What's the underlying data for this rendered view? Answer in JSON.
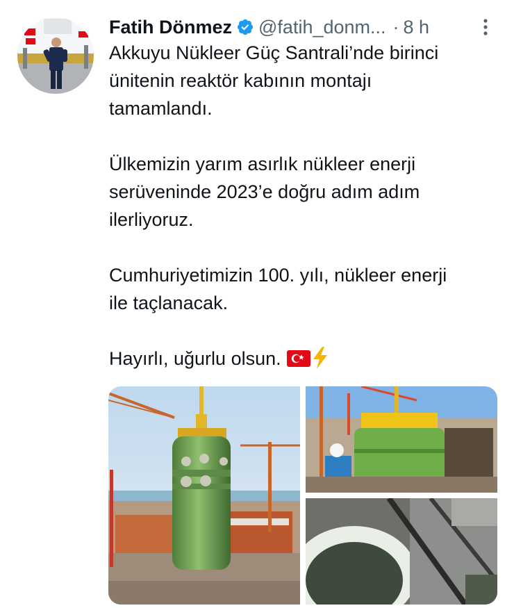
{
  "tweet": {
    "display_name": "Fatih Dönmez",
    "handle": "@fatih_donm...",
    "separator": "·",
    "time": "8 h",
    "paragraphs": [
      [
        "Akkuyu Nükleer Güç Santrali’nde birinci",
        "ünitenin reaktör kabının montajı",
        "tamamlandı."
      ],
      [
        "Ülkemizin yarım asırlık nükleer enerji",
        "serüveninde 2023’e doğru adım adım",
        "ilerliyoruz."
      ],
      [
        "Cumhuriyetimizin 100. yılı, nükleer enerji",
        "ile taçlanacak."
      ]
    ],
    "closing": "Hayırlı, uğurlu olsun.",
    "emojis": [
      "turkey-flag-icon",
      "high-voltage-icon"
    ]
  },
  "icons": {
    "verified": "verified-badge-icon",
    "more": "more-options-icon"
  },
  "colors": {
    "text": "#0f1419",
    "secondary": "#536471",
    "verified_blue": "#1d9bf0",
    "flag_red": "#e30a17"
  }
}
